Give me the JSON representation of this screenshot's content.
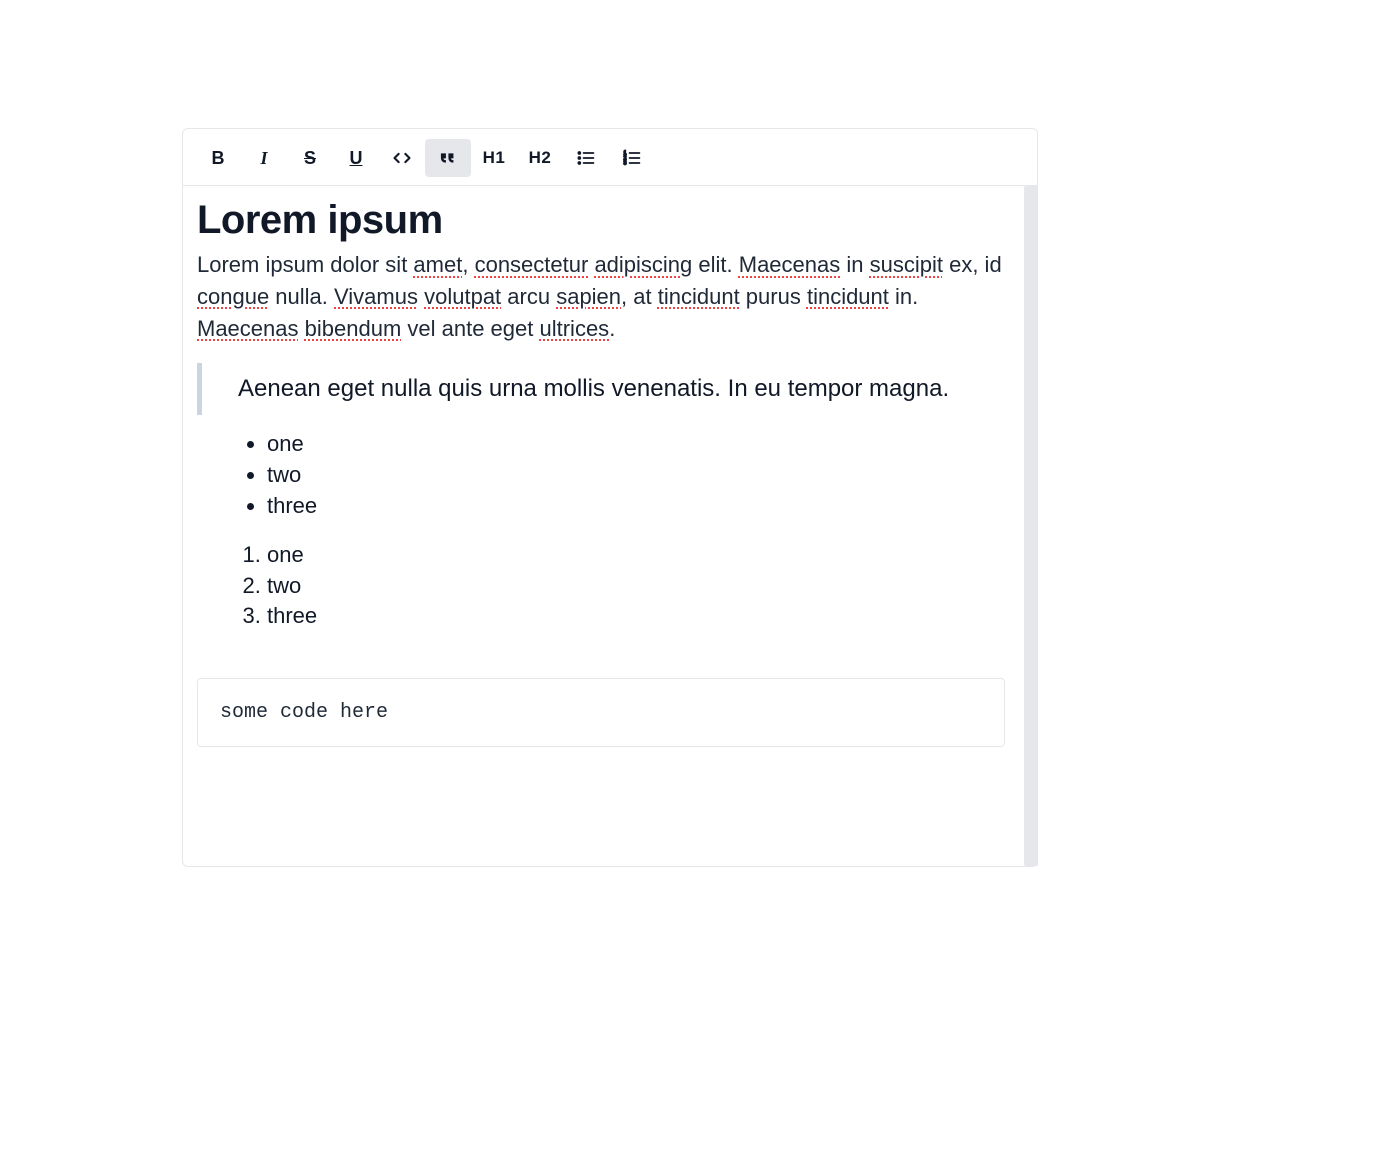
{
  "toolbar": {
    "bold": "B",
    "italic": "I",
    "strike": "S",
    "underline": "U",
    "code": "<>",
    "quote": "❝❝",
    "h1": "H1",
    "h2": "H2",
    "active": "quote"
  },
  "content": {
    "title": "Lorem ipsum",
    "paragraph_segments": [
      {
        "text": "Lorem ipsum dolor sit ",
        "spell": false
      },
      {
        "text": "amet",
        "spell": true
      },
      {
        "text": ", ",
        "spell": false
      },
      {
        "text": "consectetur",
        "spell": true
      },
      {
        "text": " ",
        "spell": false
      },
      {
        "text": "adipiscing",
        "spell": true
      },
      {
        "text": " elit. ",
        "spell": false
      },
      {
        "text": "Maecenas",
        "spell": true
      },
      {
        "text": " in ",
        "spell": false
      },
      {
        "text": "suscipit",
        "spell": true
      },
      {
        "text": " ex, id ",
        "spell": false
      },
      {
        "text": "congue",
        "spell": true
      },
      {
        "text": " nulla. ",
        "spell": false
      },
      {
        "text": "Vivamus",
        "spell": true
      },
      {
        "text": " ",
        "spell": false
      },
      {
        "text": "volutpat",
        "spell": true
      },
      {
        "text": " arcu ",
        "spell": false
      },
      {
        "text": "sapien",
        "spell": true
      },
      {
        "text": ", at ",
        "spell": false
      },
      {
        "text": "tincidunt",
        "spell": true
      },
      {
        "text": " purus ",
        "spell": false
      },
      {
        "text": "tincidunt",
        "spell": true
      },
      {
        "text": " in. ",
        "spell": false
      },
      {
        "text": "Maecenas",
        "spell": true
      },
      {
        "text": " ",
        "spell": false
      },
      {
        "text": "bibendum",
        "spell": true
      },
      {
        "text": " vel ante eget ",
        "spell": false
      },
      {
        "text": "ultrices",
        "spell": true
      },
      {
        "text": ".",
        "spell": false
      }
    ],
    "blockquote": "Aenean eget nulla quis urna mollis venenatis. In eu tempor magna.",
    "ul": [
      "one",
      "two",
      "three"
    ],
    "ol": [
      "one",
      "two",
      "three"
    ],
    "code": "some code here"
  }
}
